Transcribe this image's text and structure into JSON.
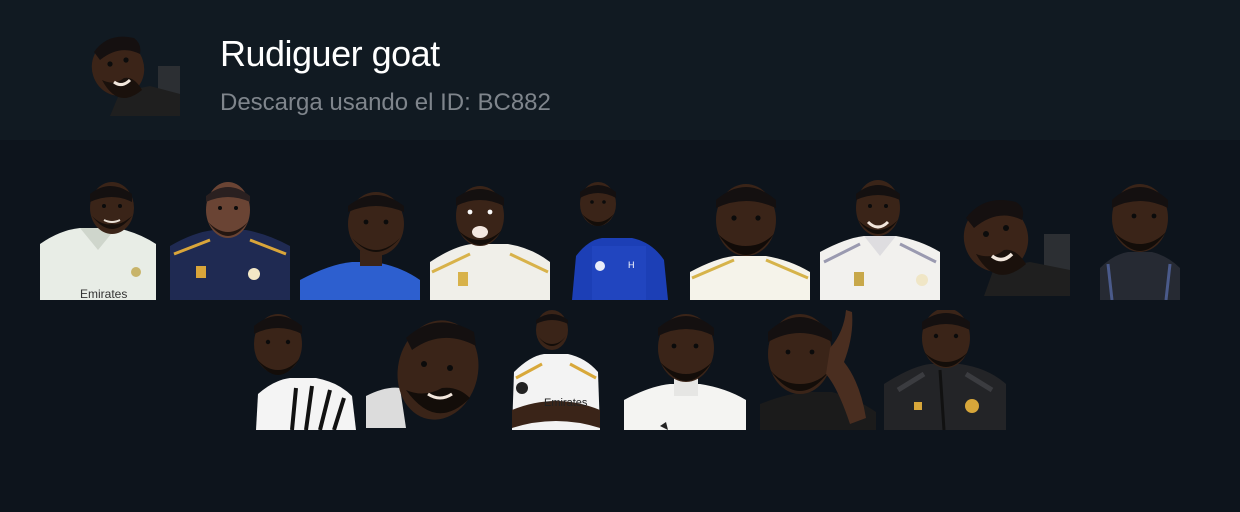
{
  "pack": {
    "title": "Rudiguer goat",
    "subtitle": "Descarga usando el ID: BC882",
    "icon": "sticker-pack-cover"
  },
  "stickers": [
    {
      "name": "sticker-white-kit-smile",
      "shirt": "#e8ede6",
      "accent": "#c8b46a",
      "text": "Emirates",
      "bg": "none"
    },
    {
      "name": "sticker-navy-kit-smile",
      "shirt": "#1f2a52",
      "accent": "#d9a53a",
      "text": "",
      "bg": "none"
    },
    {
      "name": "sticker-blue-kit-neutral",
      "shirt": "#2d5fcf",
      "accent": "#2d5fcf",
      "text": "",
      "bg": "none"
    },
    {
      "name": "sticker-white-kit-shout",
      "shirt": "#f0efe9",
      "accent": "#d8b24a",
      "text": "",
      "bg": "none"
    },
    {
      "name": "sticker-chelsea-kit-small",
      "shirt": "#1c3fb6",
      "accent": "#ffffff",
      "text": "",
      "bg": "none"
    },
    {
      "name": "sticker-white-kit-closeup",
      "shirt": "#f5f3ea",
      "accent": "#d6b34a",
      "text": "",
      "bg": "none"
    },
    {
      "name": "sticker-white-kit-laugh",
      "shirt": "#f2f1ee",
      "accent": "#9a9ab0",
      "text": "",
      "bg": "none"
    },
    {
      "name": "sticker-face-tilt",
      "shirt": "#2a2a2a",
      "accent": "#2a2a2a",
      "text": "",
      "bg": "#2c2f33"
    },
    {
      "name": "sticker-suit-sideeye",
      "shirt": "#262a33",
      "accent": "#4a5a8a",
      "text": "",
      "bg": "none"
    },
    {
      "name": "sticker-stripes-kit",
      "shirt": "#f4f4f4",
      "accent": "#111111",
      "text": "",
      "bg": "none"
    },
    {
      "name": "sticker-face-closeup-grin",
      "shirt": "#dcdcdc",
      "accent": "#dcdcdc",
      "text": "",
      "bg": "none"
    },
    {
      "name": "sticker-arms-crossed",
      "shirt": "#f3f3f3",
      "accent": "#d8a83a",
      "text": "Emirates",
      "bg": "none"
    },
    {
      "name": "sticker-training-top",
      "shirt": "#f4f4f2",
      "accent": "#cfcfcf",
      "text": "",
      "bg": "none"
    },
    {
      "name": "sticker-hand-ear",
      "shirt": "#1b1b1b",
      "accent": "#1b1b1b",
      "text": "",
      "bg": "none"
    },
    {
      "name": "sticker-dark-jacket",
      "shirt": "#232427",
      "accent": "#d7a63a",
      "text": "",
      "bg": "none"
    }
  ]
}
